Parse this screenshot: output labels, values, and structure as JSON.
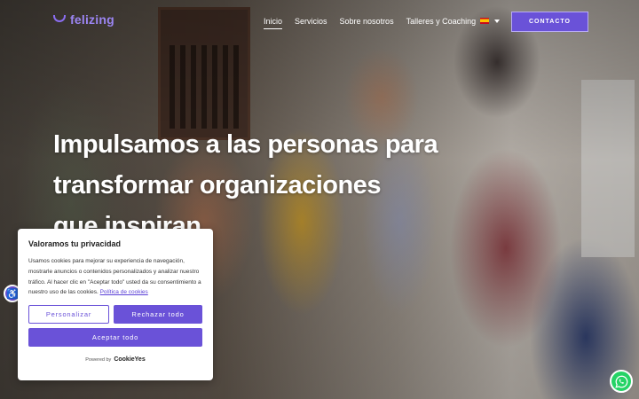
{
  "header": {
    "logo_text": "felizing",
    "nav": [
      "Inicio",
      "Servicios",
      "Sobre nosotros",
      "Talleres y Coaching"
    ],
    "active_nav": "Inicio",
    "language_flag": "es-flag-icon",
    "contact_label": "CONTACTO"
  },
  "hero": {
    "headline_line1": "Impulsamos a las personas para",
    "headline_line2": "transformar organizaciones",
    "headline_line3": "que inspiran"
  },
  "cookie_banner": {
    "title": "Valoramos tu privacidad",
    "body": "Usamos cookies para mejorar su experiencia de navegación, mostrarle anuncios o contenidos personalizados y analizar nuestro tráfico. Al hacer clic en \"Aceptar todo\" usted da su consentimiento a nuestro uso de las cookies.",
    "policy_link": "Política de cookies",
    "customize_label": "Personalizar",
    "reject_label": "Rechazar todo",
    "accept_label": "Aceptar todo",
    "powered_by": "Powered by",
    "powered_brand": "CookieYes"
  },
  "colors": {
    "brand": "#6a52d8",
    "logo": "#9b85f2",
    "whatsapp": "#25d366"
  },
  "icons": {
    "accessibility": "accessibility-icon",
    "whatsapp": "whatsapp-icon"
  }
}
